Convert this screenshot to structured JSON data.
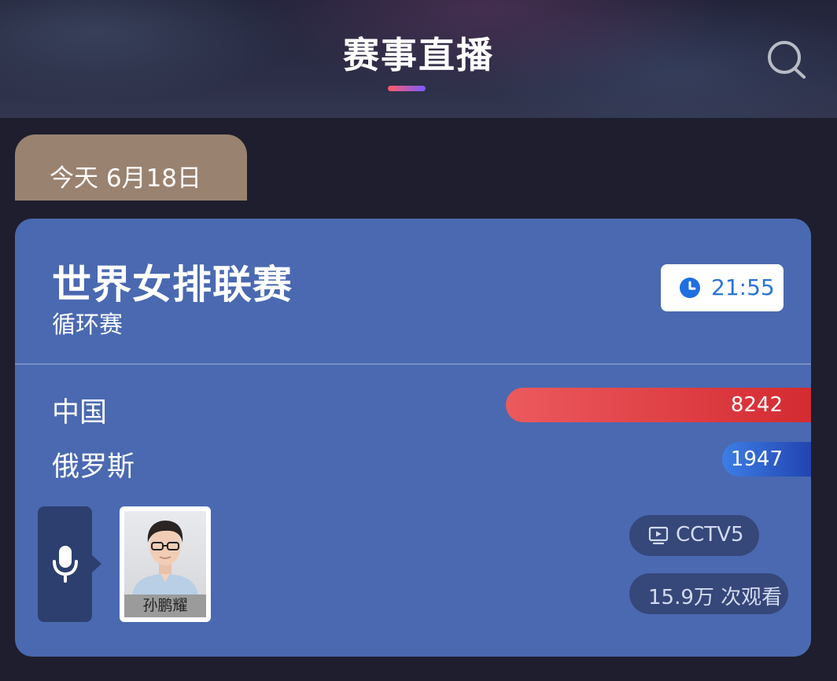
{
  "header": {
    "title": "赛事直播",
    "search_icon": "search-icon"
  },
  "date_tab": {
    "label": "今天 6月18日"
  },
  "match_card": {
    "title": "世界女排联赛",
    "subtitle": "循环赛",
    "time": "21:55",
    "time_icon": "clock-icon",
    "teams": [
      {
        "name": "中国",
        "votes": "8242",
        "bar_color": "#e0393f"
      },
      {
        "name": "俄罗斯",
        "votes": "1947",
        "bar_color": "#2d5ccc"
      }
    ],
    "commentator": {
      "name": "孙鹏耀",
      "mic_icon": "microphone-icon"
    },
    "channel": "CCTV5",
    "channel_icon": "tv-play-icon",
    "views": "15.9万 次观看"
  },
  "colors": {
    "card_bg": "#4a69b1",
    "page_bg": "#1f1e2e",
    "date_tab_bg": "#9a8270",
    "accent_blue": "#2a73d6"
  }
}
